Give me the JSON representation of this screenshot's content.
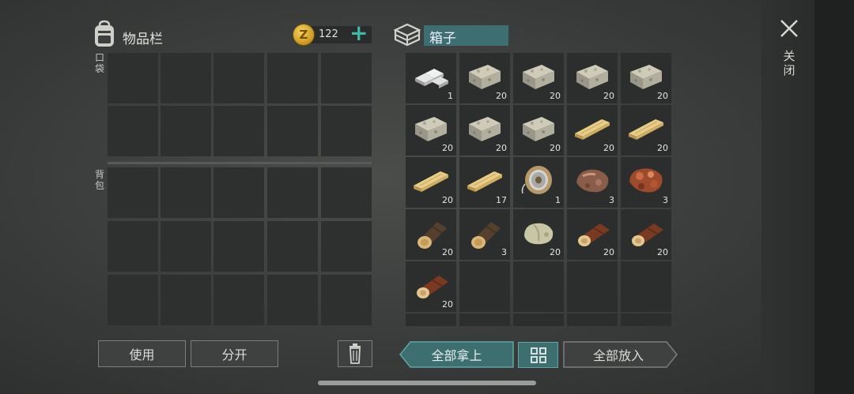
{
  "inventory": {
    "title": "物品栏",
    "pocket_label": "口袋",
    "backpack_label": "背包"
  },
  "currency": {
    "value": "122",
    "coin_symbol": "Z",
    "add_symbol": "+"
  },
  "box": {
    "name": "箱子"
  },
  "box_items": [
    {
      "icon": "metal-ingot-icon",
      "qty": "1"
    },
    {
      "icon": "stone-icon",
      "qty": "20"
    },
    {
      "icon": "stone-icon",
      "qty": "20"
    },
    {
      "icon": "stone-icon",
      "qty": "20"
    },
    {
      "icon": "stone-icon",
      "qty": "20"
    },
    {
      "icon": "stone-icon",
      "qty": "20"
    },
    {
      "icon": "stone-icon",
      "qty": "20"
    },
    {
      "icon": "stone-icon",
      "qty": "20"
    },
    {
      "icon": "plank-icon",
      "qty": "20"
    },
    {
      "icon": "plank-icon",
      "qty": "20"
    },
    {
      "icon": "plank-icon",
      "qty": "20"
    },
    {
      "icon": "plank-icon",
      "qty": "17"
    },
    {
      "icon": "wire-spool-icon",
      "qty": "1"
    },
    {
      "icon": "iron-ore-icon",
      "qty": "3"
    },
    {
      "icon": "copper-ore-icon",
      "qty": "3"
    },
    {
      "icon": "pine-log-icon",
      "qty": "20"
    },
    {
      "icon": "pine-log-icon",
      "qty": "3"
    },
    {
      "icon": "limestone-icon",
      "qty": "20"
    },
    {
      "icon": "oak-log-icon",
      "qty": "20"
    },
    {
      "icon": "oak-log-icon",
      "qty": "20"
    },
    {
      "icon": "oak-log-icon",
      "qty": "20"
    }
  ],
  "buttons": {
    "use": "使用",
    "split": "分开",
    "take_all": "全部拿上",
    "put_all": "全部放入",
    "close": "关闭"
  },
  "colors": {
    "accent": "#3d6e70",
    "accent_border": "#5fa6a4",
    "plus": "#3fb8aa"
  }
}
